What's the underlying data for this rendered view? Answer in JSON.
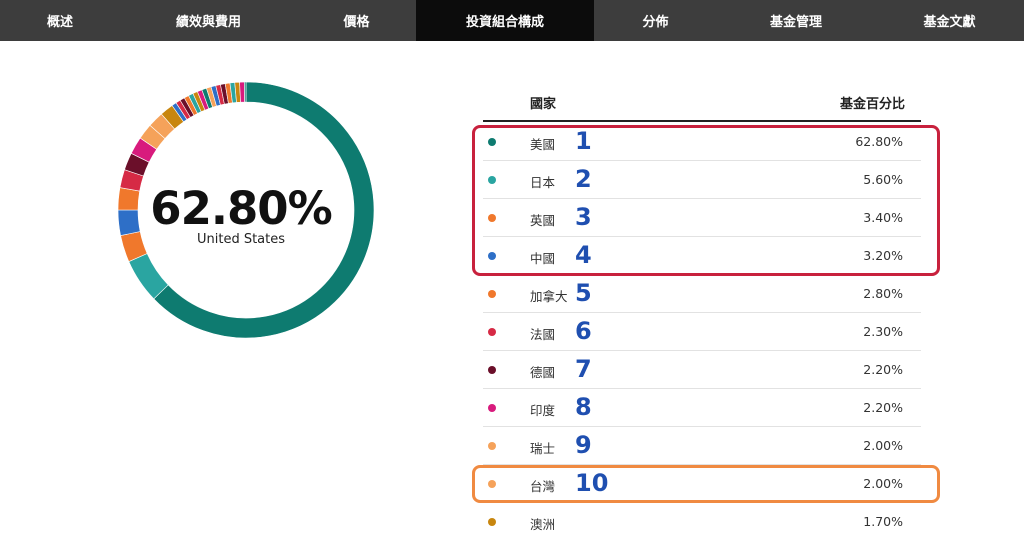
{
  "nav": {
    "tabs": [
      {
        "label": "概述"
      },
      {
        "label": "績效與費用"
      },
      {
        "label": "價格"
      },
      {
        "label": "投資組合構成",
        "active": true
      },
      {
        "label": "分佈"
      },
      {
        "label": "基金管理"
      },
      {
        "label": "基金文獻"
      }
    ]
  },
  "summary": {
    "percent": "62.80%",
    "country": "United States"
  },
  "table": {
    "col_country": "國家",
    "col_percent": "基金百分比",
    "rows": [
      {
        "rank": "1",
        "name": "美國",
        "percent": "62.80%",
        "value": 62.8,
        "color": "#0e7b70"
      },
      {
        "rank": "2",
        "name": "日本",
        "percent": "5.60%",
        "value": 5.6,
        "color": "#2aa5a1"
      },
      {
        "rank": "3",
        "name": "英國",
        "percent": "3.40%",
        "value": 3.4,
        "color": "#f0782c"
      },
      {
        "rank": "4",
        "name": "中國",
        "percent": "3.20%",
        "value": 3.2,
        "color": "#2e6fc7"
      },
      {
        "rank": "5",
        "name": "加拿大",
        "percent": "2.80%",
        "value": 2.8,
        "color": "#f0782c"
      },
      {
        "rank": "6",
        "name": "法國",
        "percent": "2.30%",
        "value": 2.3,
        "color": "#d62a45"
      },
      {
        "rank": "7",
        "name": "德國",
        "percent": "2.20%",
        "value": 2.2,
        "color": "#6b0f2a"
      },
      {
        "rank": "8",
        "name": "印度",
        "percent": "2.20%",
        "value": 2.2,
        "color": "#d81b7d"
      },
      {
        "rank": "9",
        "name": "瑞士",
        "percent": "2.00%",
        "value": 2.0,
        "color": "#f5a25a"
      },
      {
        "rank": "10",
        "name": "台灣",
        "percent": "2.00%",
        "value": 2.0,
        "color": "#f5a25a"
      },
      {
        "rank": "",
        "name": "澳洲",
        "percent": "1.70%",
        "value": 1.7,
        "color": "#c8860f"
      }
    ]
  },
  "highlights": {
    "red_color": "#c8213d",
    "orange_color": "#f08a41",
    "number_color": "#1f4fb0"
  }
}
